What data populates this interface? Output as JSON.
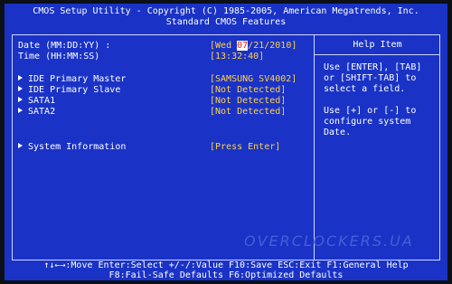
{
  "header": {
    "line1": "CMOS Setup Utility - Copyright (C) 1985-2005, American Megatrends, Inc.",
    "line2": "Standard CMOS Features"
  },
  "settings": {
    "date": {
      "label": "Date (MM:DD:YY) :",
      "open": "[",
      "weekday": "Wed ",
      "month": "07",
      "rest": "/21/2010]"
    },
    "time": {
      "label": "Time (HH:MM:SS)",
      "value": "[13:32:40]"
    },
    "items": [
      {
        "label": "IDE Primary Master",
        "value": "[SAMSUNG SV4002]"
      },
      {
        "label": "IDE Primary Slave",
        "value": "[Not Detected]"
      },
      {
        "label": "SATA1",
        "value": "[Not Detected]"
      },
      {
        "label": "SATA2",
        "value": "[Not Detected]"
      }
    ],
    "system_info": {
      "label": "System Information",
      "value": "[Press Enter]"
    }
  },
  "help": {
    "title": "Help Item",
    "text1": "Use [ENTER], [TAB]\nor [SHIFT-TAB] to\nselect a field.",
    "text2": "Use [+] or [-] to\nconfigure system Date."
  },
  "watermark": "OVERCLOCKERS.UA",
  "footer": {
    "line1": "↑↓←→:Move  Enter:Select  +/-/:Value  F10:Save  ESC:Exit  F1:General Help",
    "line2": "F8:Fail-Safe Defaults   F6:Optimized Defaults"
  },
  "colors": {
    "background": "#1a33c6",
    "value": "#ffd24a",
    "highlight": "#e02020"
  }
}
